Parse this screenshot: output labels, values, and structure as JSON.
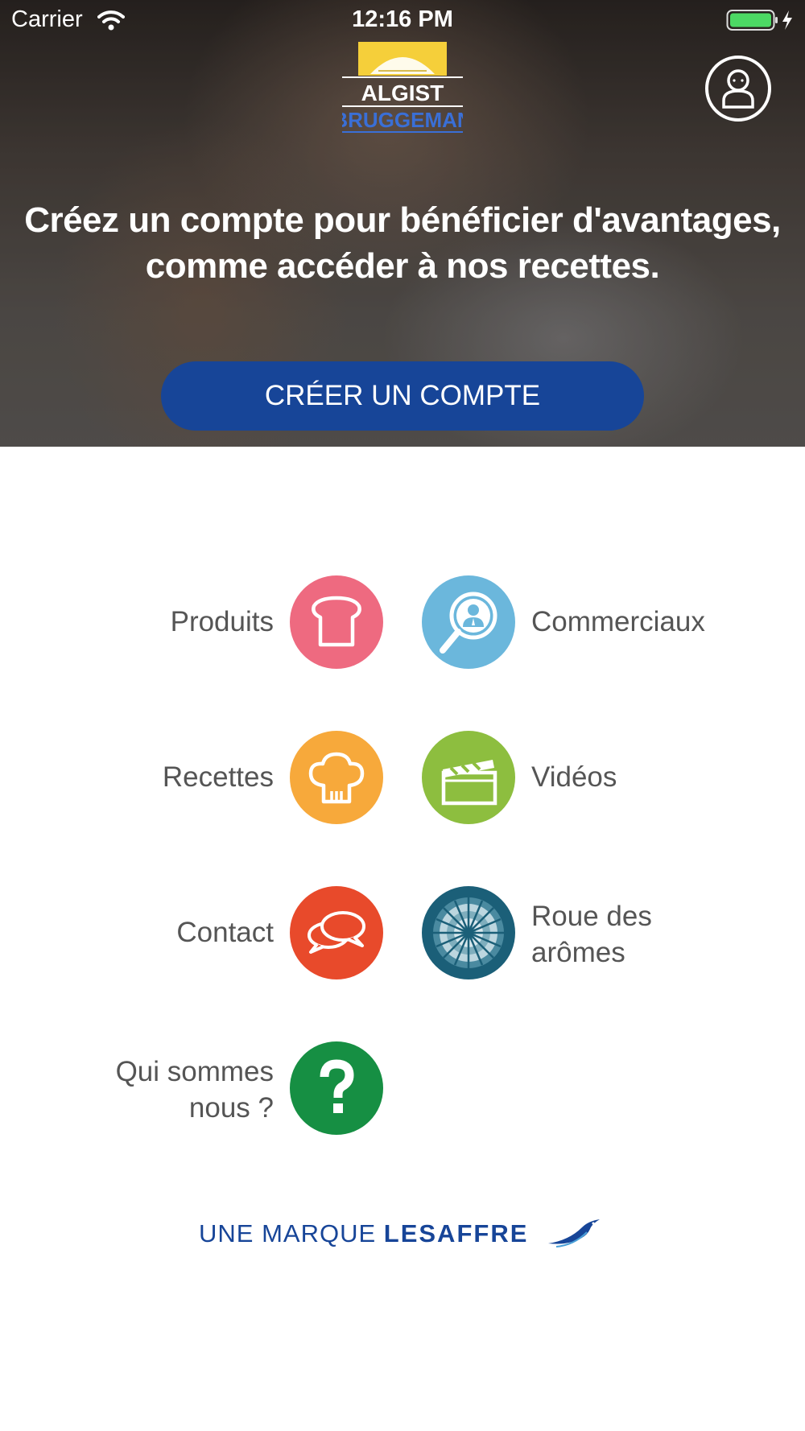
{
  "status_bar": {
    "carrier": "Carrier",
    "time": "12:16 PM"
  },
  "header": {
    "logo_top": "ALGIST",
    "logo_bottom": "BRUGGEMAN"
  },
  "hero": {
    "headline": "Créez un compte pour bénéficier d'avantages, comme accéder à nos recettes.",
    "cta_label": "CRÉER UN COMPTE"
  },
  "menu": {
    "produits": "Produits",
    "commerciaux": "Commerciaux",
    "recettes": "Recettes",
    "videos": "Vidéos",
    "contact": "Contact",
    "roue_line1": "Roue des",
    "roue_line2": "arômes",
    "qui_line1": "Qui sommes",
    "qui_line2": "nous ?"
  },
  "footer": {
    "brand_prefix": "UNE MARQUE",
    "brand_name": "LESAFFRE"
  },
  "colors": {
    "primary_blue": "#174598",
    "produits": "#ee6a80",
    "commerciaux": "#6bb7dc",
    "recettes": "#f7a93b",
    "videos": "#8dbe3f",
    "contact": "#e84a2b",
    "roue": "#1b5f78",
    "qui": "#168f43"
  }
}
